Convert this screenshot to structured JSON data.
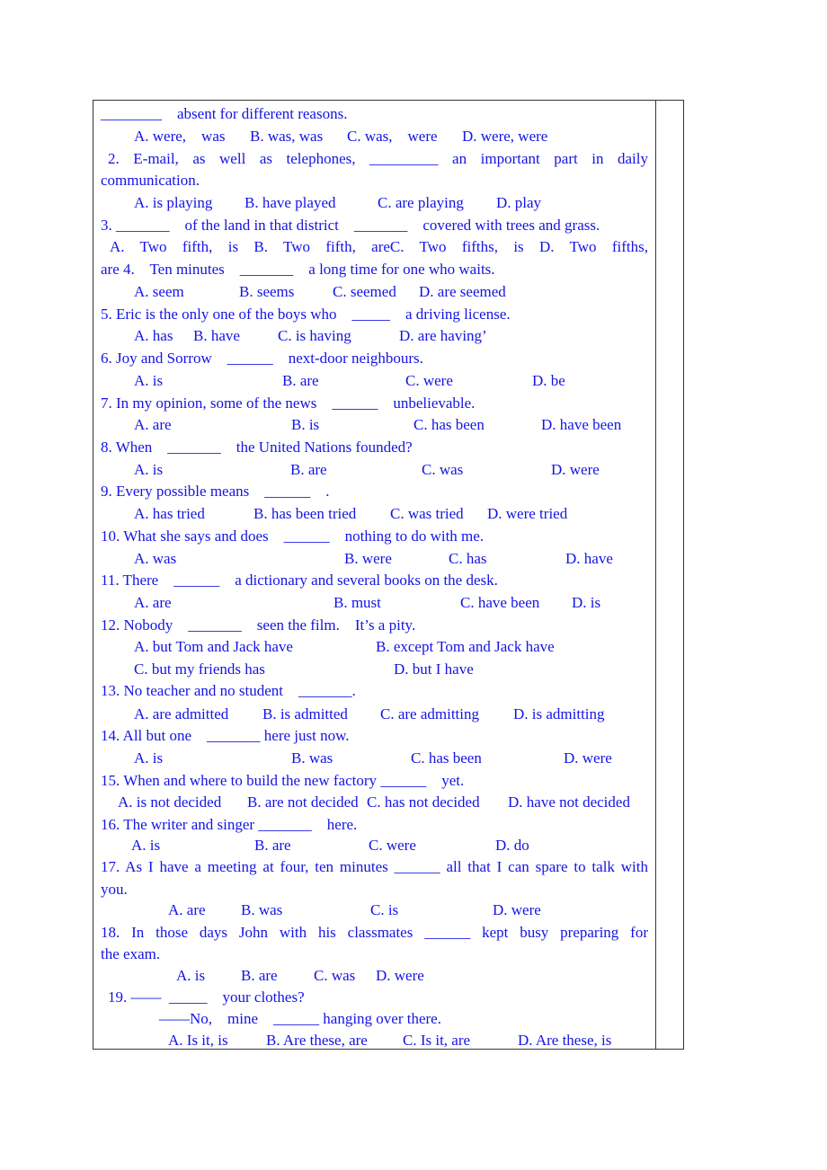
{
  "text_color": "#1414e6",
  "lines": [
    {
      "text": "________    absent for different reasons."
    },
    {
      "options": [
        "A. were,    was",
        "B. was, was",
        "C. was,    were",
        "D. were, were"
      ]
    },
    {
      "text": "2. E-mail, as well as telephones, _________ an important part in daily",
      "justify": true
    },
    {
      "text": "communication."
    },
    {
      "options": [
        "A. is playing",
        "B. have played",
        "C. are playing",
        "D. play"
      ]
    },
    {
      "text": "3. _______    of the land in that district    _______    covered with trees and grass."
    },
    {
      "text": "A. Two fifth, is B. Two fifth, areC. Two fifths, is D. Two fifths,",
      "justify": true
    },
    {
      "text": "are 4.    Ten minutes    _______    a long time for one who waits."
    },
    {
      "options": [
        "A. seem",
        "B. seems",
        "C. seemed",
        "D. are seemed"
      ]
    },
    {
      "text": "5. Eric is the only one of the boys who    _____    a driving license."
    },
    {
      "options": [
        "A. has",
        "B. have",
        "C. is having",
        "D. are having’"
      ]
    },
    {
      "text": "6. Joy and Sorrow    ______    next-door neighbours."
    },
    {
      "options": [
        "A. is",
        "B. are",
        "C. were",
        "D. be"
      ]
    },
    {
      "text": "7. In my opinion, some of the news    ______    unbelievable."
    },
    {
      "options": [
        "A. are",
        "B. is",
        "C. has been",
        "D. have been"
      ]
    },
    {
      "text": "8. When    _______    the United Nations founded?"
    },
    {
      "options": [
        "A. is",
        "B. are",
        "C. was",
        "D. were"
      ]
    },
    {
      "text": "9. Every possible means    ______    ."
    },
    {
      "options": [
        "A. has tried",
        "B. has been tried",
        "C. was tried",
        "D. were tried"
      ]
    },
    {
      "text": "10. What she says and does    ______    nothing to do with me."
    },
    {
      "options": [
        "A. was",
        "B. were",
        "C. has",
        "D. have"
      ]
    },
    {
      "text": "11. There    ______    a dictionary and several books on the desk."
    },
    {
      "options": [
        "A. are",
        "B. must",
        "C. have been",
        "D. is"
      ]
    },
    {
      "text": "12. Nobody    _______    seen the film.    It’s a pity."
    },
    {
      "options": [
        "A. but Tom and Jack have",
        "B. except Tom and Jack have"
      ]
    },
    {
      "options": [
        "C. but my friends has",
        "D. but I have"
      ]
    },
    {
      "text": "13. No teacher and no student    _______."
    },
    {
      "options": [
        "A. are admitted",
        "B. is admitted",
        "C. are admitting",
        "D. is admitting"
      ]
    },
    {
      "text": "14. All but one    _______ here just now."
    },
    {
      "options": [
        "A. is",
        "B. was",
        "C. has been",
        "D. were"
      ]
    },
    {
      "text": "15. When and where to build the new factory ______    yet."
    },
    {
      "options": [
        "A. is not decided",
        "B. are not decided",
        "C. has not decided",
        "D. have not decided"
      ]
    },
    {
      "text": "16. The writer and singer _______    here."
    },
    {
      "options": [
        "A. is",
        "B. are",
        "C. were",
        "D. do"
      ]
    },
    {
      "text": "17. As I have a meeting at four, ten minutes ______ all that I can spare to talk with",
      "justify": true
    },
    {
      "text": "you."
    },
    {
      "options": [
        "A. are",
        "B. was",
        "C. is",
        "D. were"
      ]
    },
    {
      "text": "18. In those days John with his classmates ______ kept busy preparing for",
      "justify": true
    },
    {
      "text": "the exam."
    },
    {
      "options": [
        "A. is",
        "B. are",
        "C. was",
        "D. were"
      ]
    },
    {
      "text": "19. ——  _____    your clothes?"
    },
    {
      "text": "——No,    mine    ______ hanging over there."
    },
    {
      "options": [
        "A. Is it, is",
        "B. Are these, are",
        "C. Is it, are",
        "D. Are these, is"
      ]
    }
  ]
}
